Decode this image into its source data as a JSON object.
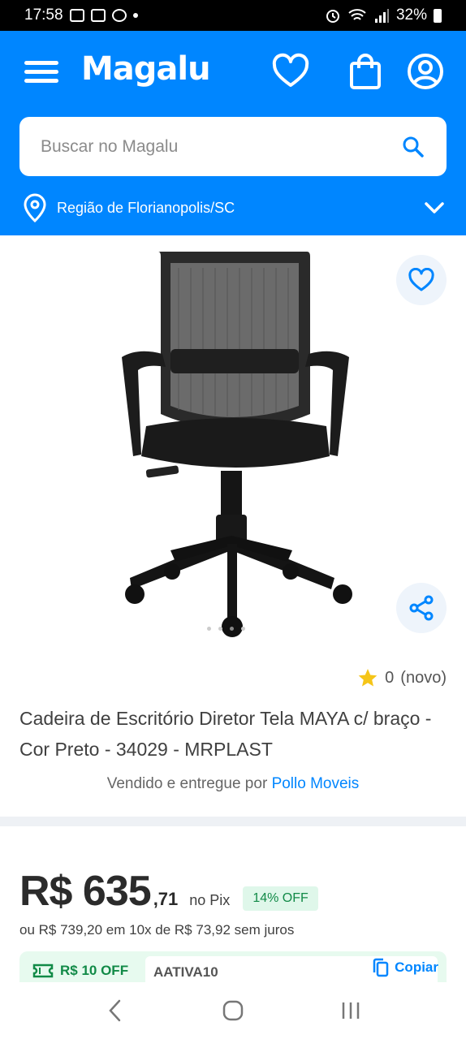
{
  "status_bar": {
    "time": "17:58",
    "battery": "32%"
  },
  "header": {
    "logo": "Magalu",
    "search_placeholder": "Buscar no Magalu",
    "region": "Região de Florianopolis/SC"
  },
  "product": {
    "rating_value": "0",
    "rating_label": "(novo)",
    "title": "Cadeira de Escritório Diretor Tela MAYA c/ braço - Cor Preto - 34029 - MRPLAST",
    "seller_prefix": "Vendido e entregue por",
    "seller_name": "Pollo Moveis",
    "image_count": 4,
    "active_image": 2
  },
  "price": {
    "main": "R$ 635",
    "cents": ",71",
    "pix_label": "no Pix",
    "discount_badge": "14% OFF",
    "installments": "ou R$ 739,20 em 10x de R$ 73,92 sem juros"
  },
  "coupon": {
    "tag": "R$ 10 OFF",
    "code": "AATIVA10",
    "copy_label": "Copiar"
  },
  "colors": {
    "brand_blue": "#0086ff",
    "success_green": "#118a47",
    "star_yellow": "#f5c518"
  }
}
